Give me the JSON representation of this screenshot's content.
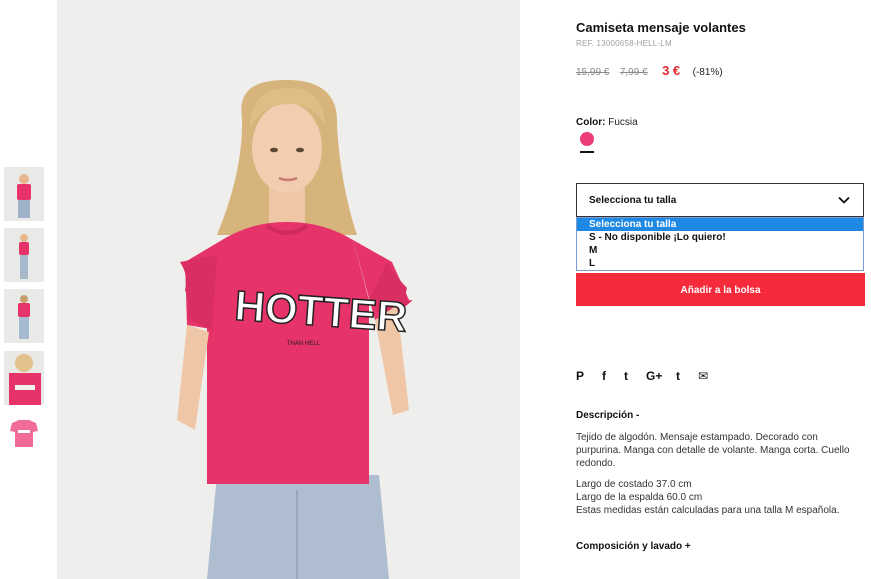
{
  "product": {
    "title": "Camiseta mensaje volantes",
    "ref": "REF. 13000658-HELL-LM",
    "price_old_1": "15,99 €",
    "price_old_2": "7,99 €",
    "price_now": "3 €",
    "discount": "(-81%)",
    "shirt_text": "HOTTER",
    "shirt_subtext": "THAN HELL"
  },
  "color": {
    "label": "Color:",
    "value": "Fucsia",
    "swatch_hex": "#ec3d76"
  },
  "size_select": {
    "label": "Selecciona tu talla",
    "options": [
      "Selecciona tu talla",
      "S - No disponible ¡Lo quiero!",
      "M",
      "L"
    ],
    "selected_index": 0
  },
  "actions": {
    "add_to_bag": "Añadir a la bolsa"
  },
  "social_icons": [
    "pinterest-icon",
    "facebook-icon",
    "twitter-icon",
    "google-plus-icon",
    "tumblr-icon",
    "email-icon"
  ],
  "social_glyphs": [
    "P",
    "f",
    "t",
    "G+",
    "t",
    "✉"
  ],
  "description": {
    "heading": "Descripción -",
    "body": "Tejido de algodón. Mensaje estampado. Decorado con purpurina. Manga con detalle de volante. Manga corta. Cuello redondo.",
    "measure_1": "Largo de costado 37.0 cm",
    "measure_2": "Largo de la espalda 60.0 cm",
    "measure_3": "Estas medidas están calculadas para una talla M española."
  },
  "composition": {
    "heading": "Composición y lavado +"
  },
  "colors": {
    "accent_red": "#f52a3a",
    "price_red": "#e3262e",
    "shirt_pink": "#e6336a",
    "highlight_blue": "#1e88e5"
  }
}
